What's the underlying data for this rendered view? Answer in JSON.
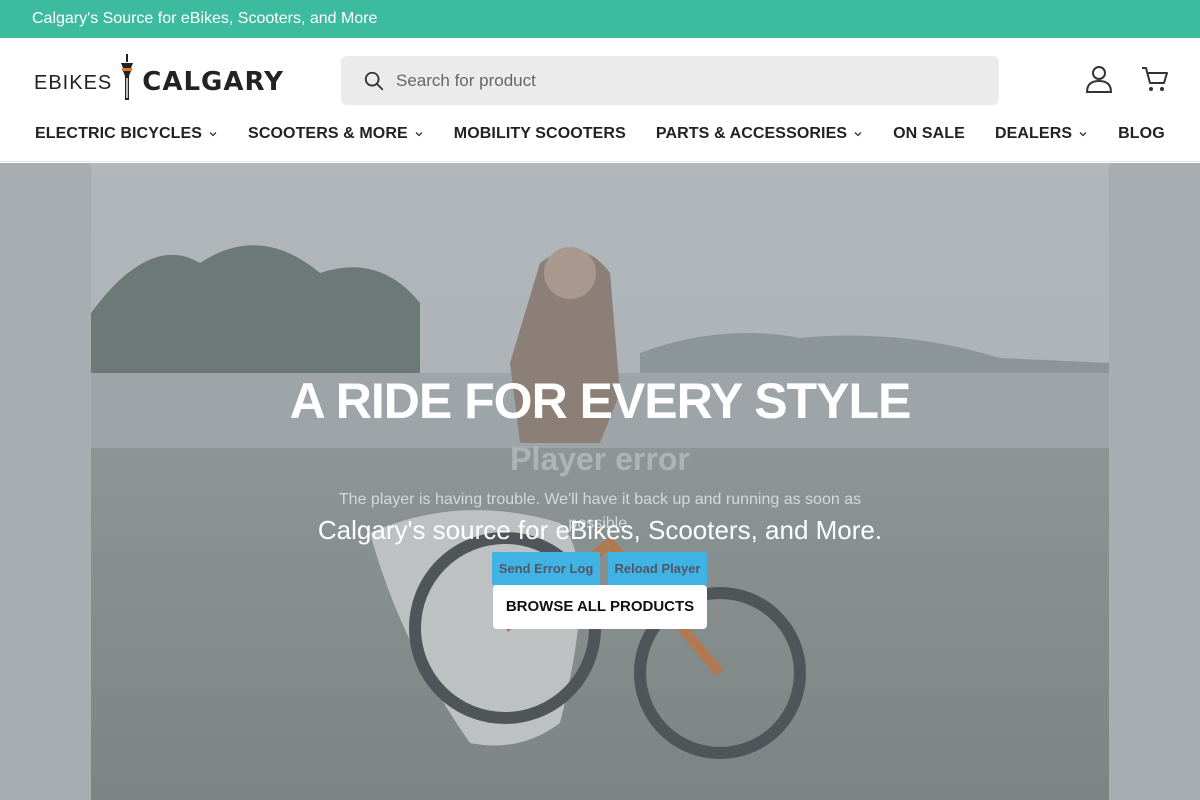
{
  "announcement": "Calgary's Source for eBikes, Scooters, and More",
  "logo": {
    "left": "EBIKES",
    "right": "CALGARY"
  },
  "search": {
    "placeholder": "Search for product"
  },
  "header_icons": [
    "account-icon",
    "cart-icon"
  ],
  "nav": [
    {
      "label": "ELECTRIC BICYCLES",
      "dropdown": true
    },
    {
      "label": "SCOOTERS & MORE",
      "dropdown": true
    },
    {
      "label": "MOBILITY SCOOTERS",
      "dropdown": false
    },
    {
      "label": "PARTS & ACCESSORIES",
      "dropdown": true
    },
    {
      "label": "ON SALE",
      "dropdown": false
    },
    {
      "label": "DEALERS",
      "dropdown": true
    },
    {
      "label": "BLOG",
      "dropdown": false
    }
  ],
  "player_error": {
    "title": "Player error",
    "message": "The player is having trouble. We'll have it back up and running as soon as possible.",
    "send_log": "Send Error Log",
    "reload": "Reload Player"
  },
  "hero": {
    "title": "A RIDE FOR EVERY STYLE",
    "subtitle": "Calgary's source for eBikes, Scooters, and More.",
    "button": "BROWSE ALL PRODUCTS"
  },
  "colors": {
    "announce_bg": "#3dbb9f",
    "accent_blue": "#3fb4e4"
  }
}
